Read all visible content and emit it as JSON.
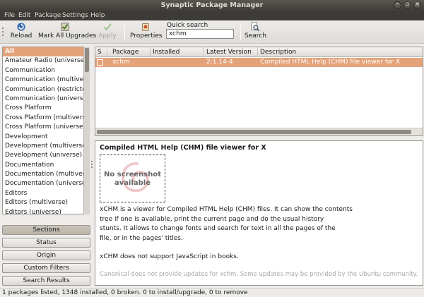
{
  "window": {
    "title": "Synaptic Package Manager"
  },
  "menu": [
    "File",
    "Edit",
    "Package",
    "Settings",
    "Help"
  ],
  "toolbar": {
    "reload": "Reload",
    "mark_all_upgrades": "Mark All Upgrades",
    "apply": "Apply",
    "properties": "Properties",
    "quick_search_label": "Quick search",
    "quick_search_value": "xchm",
    "search": "Search"
  },
  "sections": [
    "All",
    "Amateur Radio (universe)",
    "Communication",
    "Communication (multiverse)",
    "Communication (restricted)",
    "Communication (universe)",
    "Cross Platform",
    "Cross Platform (multiverse)",
    "Cross Platform (universe)",
    "Development",
    "Development (multiverse)",
    "Development (universe)",
    "Documentation",
    "Documentation (multiverse)",
    "Documentation (universe)",
    "Editors",
    "Editors (multiverse)",
    "Editors (universe)"
  ],
  "filter_buttons": {
    "sections": "Sections",
    "status": "Status",
    "origin": "Origin",
    "custom_filters": "Custom Filters",
    "search_results": "Search Results"
  },
  "table": {
    "columns": [
      "S",
      "Package",
      "Installed Version",
      "Latest Version",
      "Description"
    ],
    "rows": [
      {
        "package": "xchm",
        "installed": "",
        "latest": "2:1.14-4",
        "description": "Compiled HTML Help (CHM) file viewer for X"
      }
    ]
  },
  "details": {
    "title": "Compiled HTML Help (CHM) file viewer for X",
    "screenshot_placeholder_1": "No screenshot",
    "screenshot_placeholder_2": "available",
    "desc_line_1": "xCHM is a viewer for Compiled HTML Help (CHM) files. It can show the contents",
    "desc_line_2": "tree if one is available, print the current page and do the usual history",
    "desc_line_3": "stunts. It allows to change fonts and search for text in all the pages of the",
    "desc_line_4": "file, or in the pages' titles.",
    "desc_line_5": "xCHM does not support JavaScript in books.",
    "canonical_note": "Canonical does not provide updates for xchm. Some updates may be provided by the Ubuntu community."
  },
  "status": "1 packages listed, 1348 installed, 0 broken. 0 to install/upgrade, 0 to remove",
  "colors": {
    "selection": "#e3a27a",
    "titlebar": "#3c3b37"
  }
}
